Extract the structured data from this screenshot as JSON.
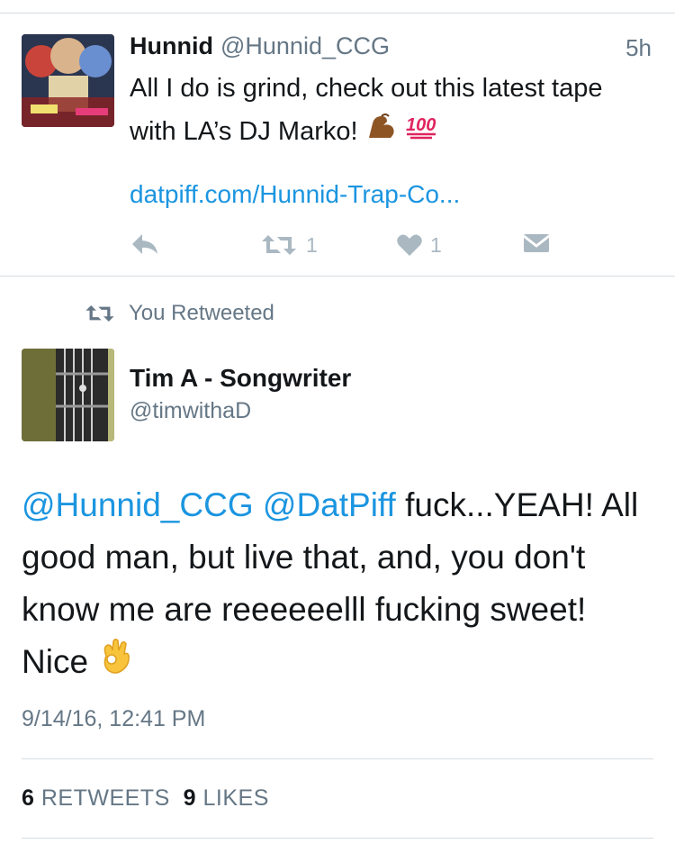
{
  "tweet1": {
    "name": "Hunnid",
    "handle": "@Hunnid_CCG",
    "time": "5h",
    "text": "All I do is grind, check out this latest tape with LA’s DJ Marko!",
    "link": "datpiff.com/Hunnid-Trap-Co...",
    "retweet_count": "1",
    "like_count": "1"
  },
  "retweet_banner": "You Retweeted",
  "tweet2": {
    "name": "Tim A - Songwriter",
    "handle": "@timwithaD",
    "mention1": "@Hunnid_CCG",
    "mention2": "@DatPiff",
    "text": "fuck...YEAH! All good man, but live that, and, you don't know me are reeeeeelll fucking sweet! Nice",
    "date": "9/14/16, 12:41 PM",
    "retweets_count": "6",
    "retweets_label": "RETWEETS",
    "likes_count": "9",
    "likes_label": "LIKES"
  },
  "colors": {
    "link": "#1b95e0",
    "muted": "#657786",
    "icon": "#aab8c2"
  }
}
